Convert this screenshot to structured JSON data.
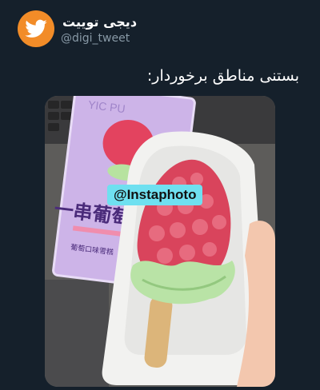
{
  "tweet": {
    "display_name": "دیجی توییت",
    "handle": "@digi_tweet",
    "text": "بستنی مناطق برخوردار:",
    "avatar_icon": "twitter-bird-icon",
    "accent": "#f28c28"
  },
  "media": {
    "watermark": "@Instaphoto",
    "package_text_1": "一串葡萄",
    "package_text_2": "YIC PU",
    "package_text_3": "葡萄口味雪糕"
  }
}
